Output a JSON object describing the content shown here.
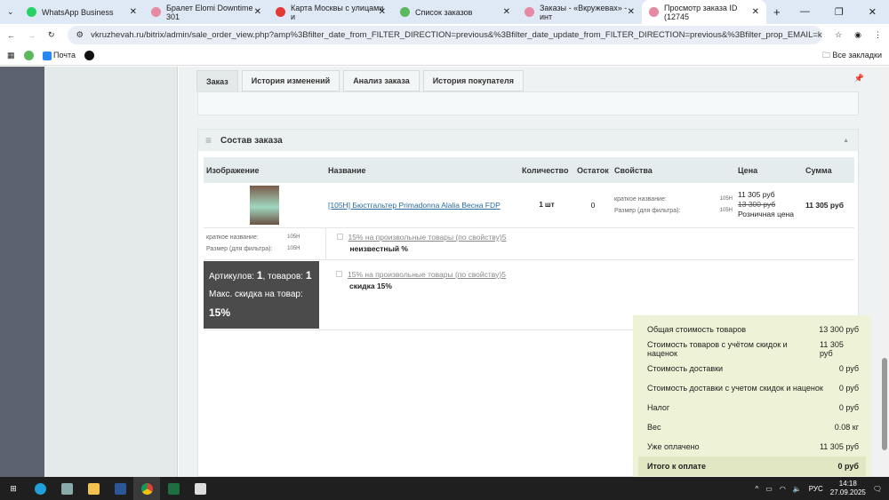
{
  "browser": {
    "tabs": [
      {
        "title": "WhatsApp Business",
        "color": "#25d366"
      },
      {
        "title": "Бралет Elomi Downtime 301",
        "color": "#e58aa0"
      },
      {
        "title": "Карта Москвы с улицами и",
        "color": "#e53935"
      },
      {
        "title": "Список заказов",
        "color": "#5cb85c"
      },
      {
        "title": "Заказы - «Вкружевах» - инт",
        "color": "#e58aa0"
      },
      {
        "title": "Просмотр заказа ID (12745",
        "color": "#e58aa0"
      }
    ],
    "url": "vkruzhevah.ru/bitrix/admin/sale_order_view.php?amp%3Bfilter_date_from_FILTER_DIRECTION=previous&%3Bfilter_date_update_from_FILTER_DIRECTION=previous&%3Bfilter_prop_EMAIL=kuzdekova.malvira%40...",
    "bookmarks": {
      "mail": "Почта",
      "all": "Все закладки"
    }
  },
  "page_tabs": [
    "Заказ",
    "История изменений",
    "Анализ заказа",
    "История покупателя"
  ],
  "section_title": "Состав заказа",
  "table": {
    "headers": [
      "Изображение",
      "Название",
      "Количество",
      "Остаток",
      "Свойства",
      "Цена",
      "Сумма"
    ],
    "item": {
      "name": "[105H] Бюстгальтер Primadonna Alalia Весна FDP",
      "qty": "1 шт",
      "stock": "0",
      "props": [
        {
          "k": "краткое название:",
          "v": "105H"
        },
        {
          "k": "Размер (для фильтра):",
          "v": "105H"
        }
      ],
      "price": "11 305 руб",
      "old_price": "13 300 руб",
      "price_type": "Розничная цена",
      "sum": "11 305 руб"
    },
    "discounts": [
      {
        "name": "15% на произвольные товары (по свойству)5",
        "value": "неизвестный %"
      },
      {
        "name": "15% на произвольные товары (по свойству)5",
        "value": "скидка 15%"
      }
    ],
    "stats": {
      "articles_label": "Артикулов:",
      "articles": "1",
      "goods_label": ", товаров:",
      "goods": "1",
      "maxdisc_label": "Макс. скидка на товар:",
      "maxdisc": "15%"
    }
  },
  "summary": [
    {
      "label": "Общая стоимость товаров",
      "value": "13 300 руб"
    },
    {
      "label": "Стоимость товаров с учётом скидок и наценок",
      "value": "11 305 руб"
    },
    {
      "label": "Стоимость доставки",
      "value": "0 руб"
    },
    {
      "label": "Стоимость доставки с учетом скидок и наценок",
      "value": "0 руб"
    },
    {
      "label": "Налог",
      "value": "0 руб"
    },
    {
      "label": "Вес",
      "value": "0.08 кг"
    },
    {
      "label": "Уже оплачено",
      "value": "11 305 руб"
    }
  ],
  "total": {
    "label": "Итого к оплате",
    "value": "0 руб"
  },
  "taskbar": {
    "lang": "РУС",
    "time": "14:18",
    "date": "27.09.2025"
  }
}
